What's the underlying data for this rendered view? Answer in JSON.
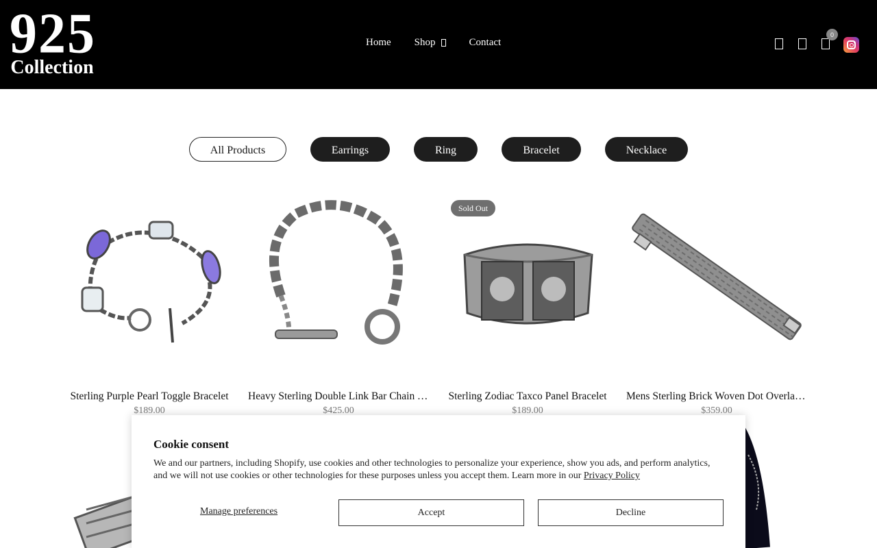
{
  "header": {
    "logo_top": "925",
    "logo_bottom": "Collection",
    "nav": [
      {
        "label": "Home"
      },
      {
        "label": "Shop"
      },
      {
        "label": "Contact"
      }
    ],
    "cart_count": "0"
  },
  "filters": [
    {
      "label": "All Products",
      "active": true
    },
    {
      "label": "Earrings",
      "active": false
    },
    {
      "label": "Ring",
      "active": false
    },
    {
      "label": "Bracelet",
      "active": false
    },
    {
      "label": "Necklace",
      "active": false
    }
  ],
  "products": [
    {
      "name": "Sterling Purple Pearl Toggle Bracelet",
      "price": "$189.00",
      "badge": ""
    },
    {
      "name": "Heavy Sterling Double Link Bar Chain Toggle Bracelet",
      "price": "$425.00",
      "badge": ""
    },
    {
      "name": "Sterling Zodiac Taxco Panel Bracelet",
      "price": "$189.00",
      "badge": "Sold Out"
    },
    {
      "name": "Mens Sterling Brick Woven Dot Overlay Bracelet",
      "price": "$359.00",
      "badge": ""
    }
  ],
  "cookie": {
    "title": "Cookie consent",
    "body": "We and our partners, including Shopify, use cookies and other technologies to personalize your experience, show you ads, and perform analytics, and we will not use cookies or other technologies for these purposes unless you accept them. Learn more in our",
    "link": "Privacy Policy",
    "manage": "Manage preferences",
    "accept": "Accept",
    "decline": "Decline"
  },
  "colors": {
    "header_bg": "#000000",
    "pill_dark": "#1e1e1e",
    "badge_bg": "#6f6f6f",
    "price": "#777777"
  }
}
